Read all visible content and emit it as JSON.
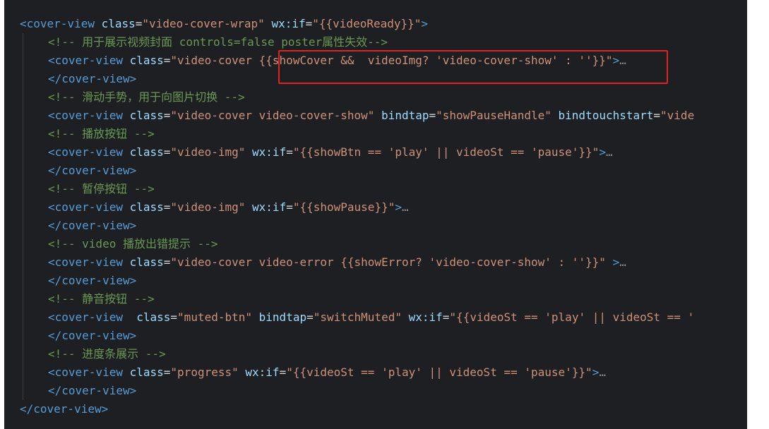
{
  "editor": {
    "lines": [
      {
        "indent": 0,
        "tokens": [
          {
            "t": "tag",
            "v": "<cover-view"
          },
          {
            "t": "txt",
            "v": " "
          },
          {
            "t": "attr",
            "v": "class"
          },
          {
            "t": "txt",
            "v": "="
          },
          {
            "t": "str",
            "v": "\"video-cover-wrap\""
          },
          {
            "t": "txt",
            "v": " "
          },
          {
            "t": "attr",
            "v": "wx:if"
          },
          {
            "t": "txt",
            "v": "="
          },
          {
            "t": "str",
            "v": "\"{{videoReady}}\""
          },
          {
            "t": "tag",
            "v": ">"
          }
        ]
      },
      {
        "indent": 1,
        "tokens": [
          {
            "t": "cmt",
            "v": "<!-- 用于展示视频封面 controls=false poster属性失效-->"
          }
        ]
      },
      {
        "indent": 1,
        "tokens": [
          {
            "t": "tag",
            "v": "<cover-view"
          },
          {
            "t": "txt",
            "v": " "
          },
          {
            "t": "attr",
            "v": "class"
          },
          {
            "t": "txt",
            "v": "="
          },
          {
            "t": "str",
            "v": "\"video-cover {{showCover &&  videoImg? 'video-cover-show' : ''}}\""
          },
          {
            "t": "tag",
            "v": ">"
          },
          {
            "t": "ell",
            "v": "…"
          }
        ]
      },
      {
        "indent": 1,
        "tokens": [
          {
            "t": "tag",
            "v": "</cover-view>"
          }
        ]
      },
      {
        "indent": 1,
        "tokens": [
          {
            "t": "cmt",
            "v": "<!-- 滑动手势，用于向图片切换 -->"
          }
        ]
      },
      {
        "indent": 1,
        "tokens": [
          {
            "t": "tag",
            "v": "<cover-view"
          },
          {
            "t": "txt",
            "v": " "
          },
          {
            "t": "attr",
            "v": "class"
          },
          {
            "t": "txt",
            "v": "="
          },
          {
            "t": "str",
            "v": "\"video-cover video-cover-show\""
          },
          {
            "t": "txt",
            "v": " "
          },
          {
            "t": "attr",
            "v": "bindtap"
          },
          {
            "t": "txt",
            "v": "="
          },
          {
            "t": "str",
            "v": "\"showPauseHandle\""
          },
          {
            "t": "txt",
            "v": " "
          },
          {
            "t": "attr",
            "v": "bindtouchstart"
          },
          {
            "t": "txt",
            "v": "="
          },
          {
            "t": "str",
            "v": "\"vide"
          }
        ]
      },
      {
        "indent": 1,
        "tokens": [
          {
            "t": "cmt",
            "v": "<!-- 播放按钮 -->"
          }
        ]
      },
      {
        "indent": 1,
        "tokens": [
          {
            "t": "tag",
            "v": "<cover-view"
          },
          {
            "t": "txt",
            "v": " "
          },
          {
            "t": "attr",
            "v": "class"
          },
          {
            "t": "txt",
            "v": "="
          },
          {
            "t": "str",
            "v": "\"video-img\""
          },
          {
            "t": "txt",
            "v": " "
          },
          {
            "t": "attr",
            "v": "wx:if"
          },
          {
            "t": "txt",
            "v": "="
          },
          {
            "t": "str",
            "v": "\"{{showBtn == 'play' || videoSt == 'pause'}}\""
          },
          {
            "t": "tag",
            "v": ">"
          },
          {
            "t": "ell",
            "v": "…"
          }
        ]
      },
      {
        "indent": 1,
        "tokens": [
          {
            "t": "tag",
            "v": "</cover-view>"
          }
        ]
      },
      {
        "indent": 1,
        "tokens": [
          {
            "t": "cmt",
            "v": "<!-- 暂停按钮 -->"
          }
        ]
      },
      {
        "indent": 1,
        "tokens": [
          {
            "t": "tag",
            "v": "<cover-view"
          },
          {
            "t": "txt",
            "v": " "
          },
          {
            "t": "attr",
            "v": "class"
          },
          {
            "t": "txt",
            "v": "="
          },
          {
            "t": "str",
            "v": "\"video-img\""
          },
          {
            "t": "txt",
            "v": " "
          },
          {
            "t": "attr",
            "v": "wx:if"
          },
          {
            "t": "txt",
            "v": "="
          },
          {
            "t": "str",
            "v": "\"{{showPause}}\""
          },
          {
            "t": "tag",
            "v": ">"
          },
          {
            "t": "ell",
            "v": "…"
          }
        ]
      },
      {
        "indent": 1,
        "tokens": [
          {
            "t": "tag",
            "v": "</cover-view>"
          }
        ]
      },
      {
        "indent": 1,
        "tokens": [
          {
            "t": "cmt",
            "v": "<!-- video 播放出错提示 -->"
          }
        ]
      },
      {
        "indent": 1,
        "tokens": [
          {
            "t": "tag",
            "v": "<cover-view"
          },
          {
            "t": "txt",
            "v": " "
          },
          {
            "t": "attr",
            "v": "class"
          },
          {
            "t": "txt",
            "v": "="
          },
          {
            "t": "str",
            "v": "\"video-cover video-error {{showError? 'video-cover-show' : ''}}\""
          },
          {
            "t": "txt",
            "v": " "
          },
          {
            "t": "tag",
            "v": ">"
          },
          {
            "t": "ell",
            "v": "…"
          }
        ]
      },
      {
        "indent": 1,
        "tokens": [
          {
            "t": "tag",
            "v": "</cover-view>"
          }
        ]
      },
      {
        "indent": 1,
        "tokens": [
          {
            "t": "cmt",
            "v": "<!-- 静音按钮 -->"
          }
        ]
      },
      {
        "indent": 1,
        "tokens": [
          {
            "t": "tag",
            "v": "<cover-view"
          },
          {
            "t": "txt",
            "v": "  "
          },
          {
            "t": "attr",
            "v": "class"
          },
          {
            "t": "txt",
            "v": "="
          },
          {
            "t": "str",
            "v": "\"muted-btn\""
          },
          {
            "t": "txt",
            "v": " "
          },
          {
            "t": "attr",
            "v": "bindtap"
          },
          {
            "t": "txt",
            "v": "="
          },
          {
            "t": "str",
            "v": "\"switchMuted\""
          },
          {
            "t": "txt",
            "v": " "
          },
          {
            "t": "attr",
            "v": "wx:if"
          },
          {
            "t": "txt",
            "v": "="
          },
          {
            "t": "str",
            "v": "\"{{videoSt == 'play' || videoSt == '"
          }
        ]
      },
      {
        "indent": 1,
        "tokens": [
          {
            "t": "tag",
            "v": "</cover-view>"
          }
        ]
      },
      {
        "indent": 1,
        "tokens": [
          {
            "t": "cmt",
            "v": "<!-- 进度条展示 -->"
          }
        ]
      },
      {
        "indent": 1,
        "tokens": [
          {
            "t": "tag",
            "v": "<cover-view"
          },
          {
            "t": "txt",
            "v": " "
          },
          {
            "t": "attr",
            "v": "class"
          },
          {
            "t": "txt",
            "v": "="
          },
          {
            "t": "str",
            "v": "\"progress\""
          },
          {
            "t": "txt",
            "v": " "
          },
          {
            "t": "attr",
            "v": "wx:if"
          },
          {
            "t": "txt",
            "v": "="
          },
          {
            "t": "str",
            "v": "\"{{videoSt == 'play' || videoSt == 'pause'}}\""
          },
          {
            "t": "tag",
            "v": ">"
          },
          {
            "t": "ell",
            "v": "…"
          }
        ]
      },
      {
        "indent": 1,
        "tokens": [
          {
            "t": "tag",
            "v": "</cover-view>"
          }
        ]
      },
      {
        "indent": 0,
        "tokens": [
          {
            "t": "tag",
            "v": "</cover-view>"
          }
        ]
      }
    ]
  },
  "colors": {
    "background": "#1e1f22",
    "tag": "#569cd6",
    "attribute": "#9cdcfe",
    "string": "#ce9178",
    "comment": "#6a9955",
    "highlight_border": "#e02424"
  }
}
